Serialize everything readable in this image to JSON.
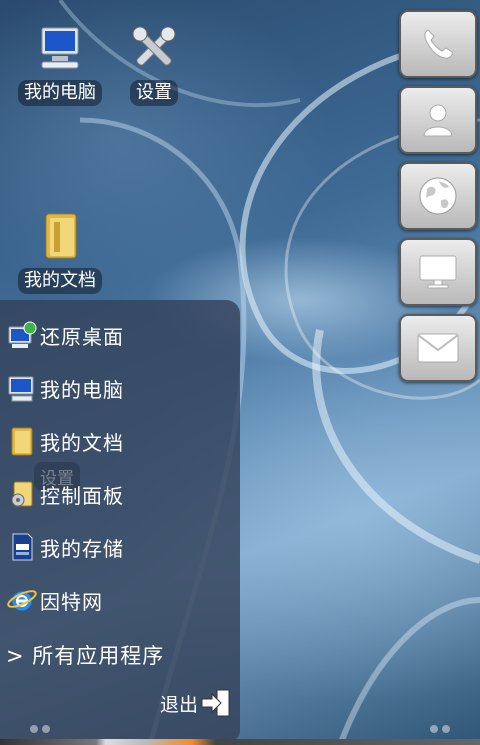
{
  "desktop": {
    "icons": [
      {
        "label": "我的电脑",
        "icon": "computer-icon"
      },
      {
        "label": "设置",
        "icon": "settings-tools-icon"
      },
      {
        "label": "我的文档",
        "icon": "folder-icon"
      }
    ],
    "ghost_label": "设置"
  },
  "dock": {
    "buttons": [
      {
        "icon": "phone-icon"
      },
      {
        "icon": "contact-icon"
      },
      {
        "icon": "globe-icon"
      },
      {
        "icon": "monitor-icon"
      },
      {
        "icon": "mail-icon"
      }
    ]
  },
  "start_menu": {
    "items": [
      {
        "label": "还原桌面",
        "icon": "restore-desktop-icon"
      },
      {
        "label": "我的电脑",
        "icon": "computer-icon"
      },
      {
        "label": "我的文档",
        "icon": "folder-icon"
      },
      {
        "label": "控制面板",
        "icon": "control-panel-icon"
      },
      {
        "label": "我的存储",
        "icon": "sd-card-icon"
      },
      {
        "label": "因特网",
        "icon": "ie-browser-icon"
      }
    ],
    "all_apps_label": "> 所有应用程序",
    "exit_label": "退出"
  },
  "colors": {
    "menu_bg": "#34425a",
    "dock_button": "#d4d4d4"
  }
}
